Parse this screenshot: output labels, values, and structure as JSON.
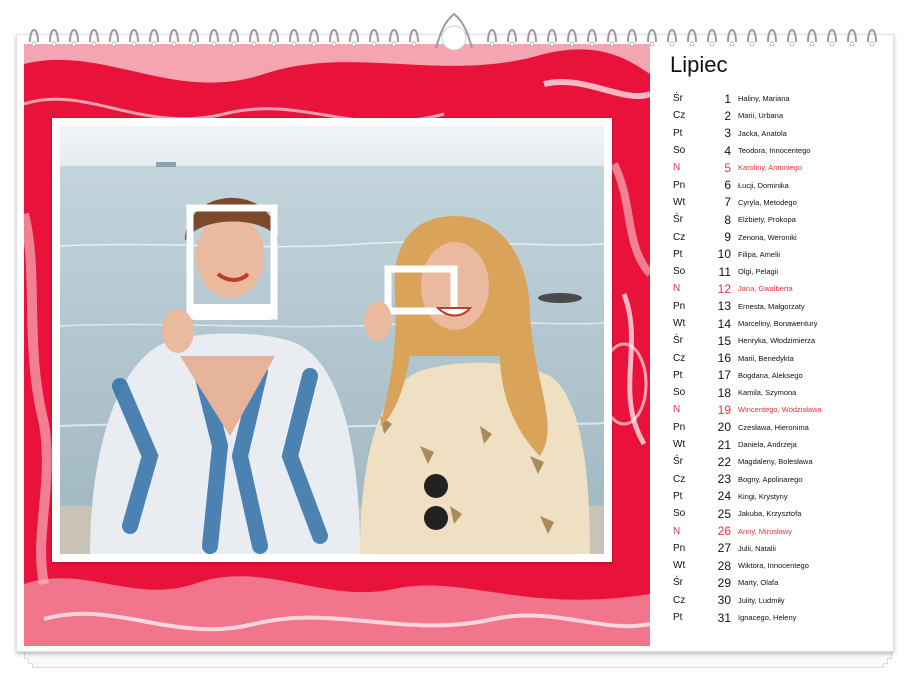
{
  "calendar": {
    "month": "Lipiec",
    "accent_color": "#e8323e",
    "days": [
      {
        "dow": "Śr",
        "num": "1",
        "names": "Haliny, Mariana",
        "sunday": false
      },
      {
        "dow": "Cz",
        "num": "2",
        "names": "Marii, Urbana",
        "sunday": false
      },
      {
        "dow": "Pt",
        "num": "3",
        "names": "Jacka, Anatola",
        "sunday": false
      },
      {
        "dow": "So",
        "num": "4",
        "names": "Teodora, Innocentego",
        "sunday": false
      },
      {
        "dow": "N",
        "num": "5",
        "names": "Karoliny, Antoniego",
        "sunday": true
      },
      {
        "dow": "Pn",
        "num": "6",
        "names": "Łucji, Dominika",
        "sunday": false
      },
      {
        "dow": "Wt",
        "num": "7",
        "names": "Cyryla, Metodego",
        "sunday": false
      },
      {
        "dow": "Śr",
        "num": "8",
        "names": "Elżbiety, Prokopa",
        "sunday": false
      },
      {
        "dow": "Cz",
        "num": "9",
        "names": "Zenona, Weroniki",
        "sunday": false
      },
      {
        "dow": "Pt",
        "num": "10",
        "names": "Filipa, Amelii",
        "sunday": false
      },
      {
        "dow": "So",
        "num": "11",
        "names": "Olgi, Pelagii",
        "sunday": false
      },
      {
        "dow": "N",
        "num": "12",
        "names": "Jana, Gwalberta",
        "sunday": true
      },
      {
        "dow": "Pn",
        "num": "13",
        "names": "Ernesta, Małgorzaty",
        "sunday": false
      },
      {
        "dow": "Wt",
        "num": "14",
        "names": "Marceliny, Bonawentury",
        "sunday": false
      },
      {
        "dow": "Śr",
        "num": "15",
        "names": "Henryka, Włodzimierza",
        "sunday": false
      },
      {
        "dow": "Cz",
        "num": "16",
        "names": "Marii, Benedykta",
        "sunday": false
      },
      {
        "dow": "Pt",
        "num": "17",
        "names": "Bogdana, Aleksego",
        "sunday": false
      },
      {
        "dow": "So",
        "num": "18",
        "names": "Kamila, Szymona",
        "sunday": false
      },
      {
        "dow": "N",
        "num": "19",
        "names": "Wincentego, Wodzisława",
        "sunday": true
      },
      {
        "dow": "Pn",
        "num": "20",
        "names": "Czesława, Hieronima",
        "sunday": false
      },
      {
        "dow": "Wt",
        "num": "21",
        "names": "Daniela, Andrzeja",
        "sunday": false
      },
      {
        "dow": "Śr",
        "num": "22",
        "names": "Magdaleny, Bolesława",
        "sunday": false
      },
      {
        "dow": "Cz",
        "num": "23",
        "names": "Bogny, Apolinarego",
        "sunday": false
      },
      {
        "dow": "Pt",
        "num": "24",
        "names": "Kingi, Krystyny",
        "sunday": false
      },
      {
        "dow": "So",
        "num": "25",
        "names": "Jakuba, Krzysztofa",
        "sunday": false
      },
      {
        "dow": "N",
        "num": "26",
        "names": "Anny, Mirosławy",
        "sunday": true
      },
      {
        "dow": "Pn",
        "num": "27",
        "names": "Julii, Natalii",
        "sunday": false
      },
      {
        "dow": "Wt",
        "num": "28",
        "names": "Wiktora, Innocentego",
        "sunday": false
      },
      {
        "dow": "Śr",
        "num": "29",
        "names": "Marty, Olafa",
        "sunday": false
      },
      {
        "dow": "Cz",
        "num": "30",
        "names": "Julity, Ludmiły",
        "sunday": false
      },
      {
        "dow": "Pt",
        "num": "31",
        "names": "Ignacego, Heleny",
        "sunday": false
      }
    ]
  },
  "colors": {
    "marble_red": "#e8123a",
    "marble_light": "#f7c9cf",
    "sea": "#b9cdd6",
    "sky": "#eef2f4"
  }
}
